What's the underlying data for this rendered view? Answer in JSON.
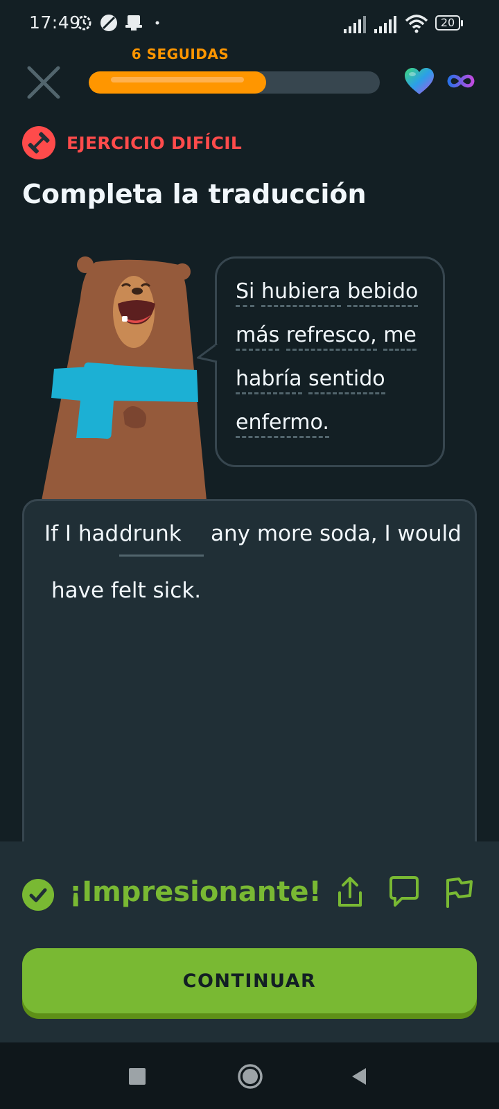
{
  "status_bar": {
    "time": "17:49",
    "battery": "20",
    "icons": [
      "settings-sync-icon",
      "no-signal-icon",
      "notification-icon",
      "dot-icon",
      "signal-icon",
      "signal-icon",
      "wifi-icon",
      "battery-icon"
    ]
  },
  "header": {
    "streak_label": "6 SEGUIDAS",
    "progress": 0.61,
    "icons": [
      "close-icon",
      "heart-icon",
      "infinity-icon"
    ]
  },
  "exercise": {
    "badge_label": "EJERCICIO DIFÍCIL",
    "instruction": "Completa la traducción",
    "prompt_lines": [
      [
        "Si",
        "hubiera",
        "bebido"
      ],
      [
        "más",
        "refresco,",
        "me"
      ],
      [
        "habría",
        "sentido"
      ],
      [
        "enfermo."
      ]
    ],
    "answer_before": "If I had",
    "answer_filled": "drunk",
    "answer_after": "any more soda, I would",
    "answer_line2": "have felt sick."
  },
  "feedback": {
    "message": "¡Impresionante!",
    "continue_label": "CONTINUAR",
    "icons": [
      "check-icon",
      "share-icon",
      "comment-icon",
      "flag-icon"
    ]
  },
  "colors": {
    "background": "#131f24",
    "orange": "#ff9600",
    "red": "#ff4b4b",
    "green": "#79b933",
    "panel": "#202f36"
  }
}
